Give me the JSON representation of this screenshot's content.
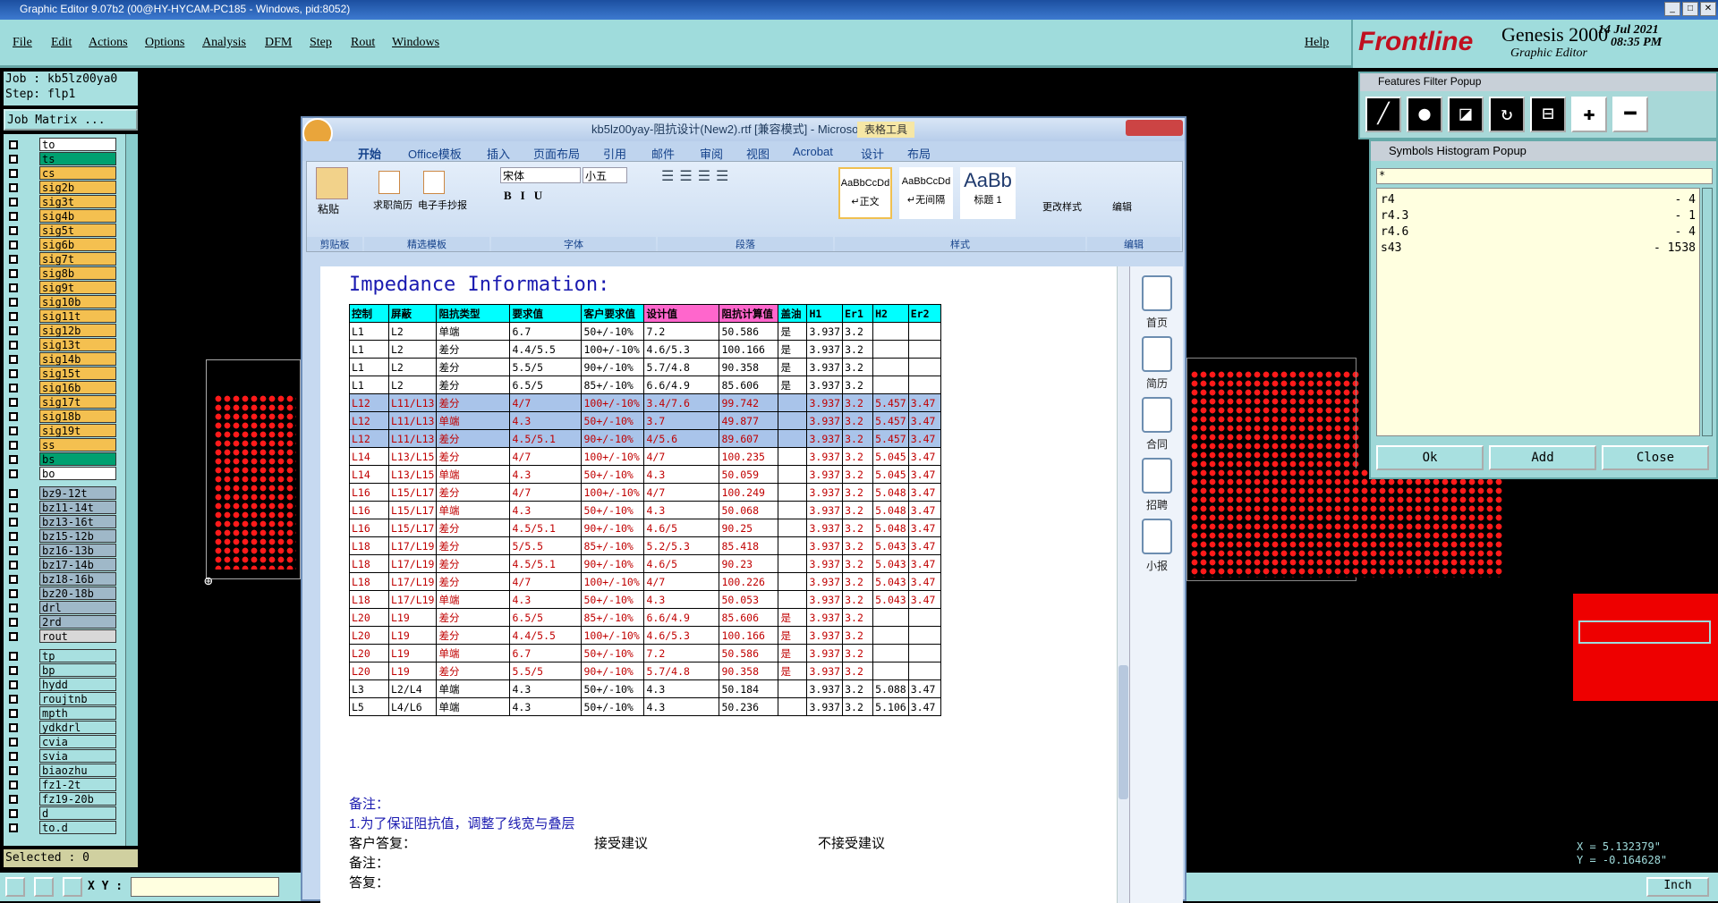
{
  "window_title": "Graphic Editor 9.07b2 (00@HY-HYCAM-PC185 - Windows, pid:8052)",
  "menu": [
    "File",
    "Edit",
    "Actions",
    "Options",
    "Analysis",
    "DFM",
    "Step",
    "Rout",
    "Windows"
  ],
  "help": "Help",
  "brand": {
    "logo": "Frontline",
    "product": "Genesis 2000",
    "subtitle": "Graphic Editor",
    "date": "14 Jul 2021",
    "time": "08:35 PM"
  },
  "job": "Job : kb5lz00ya0",
  "step": "Step: flp1",
  "job_matrix": "Job Matrix ...",
  "layers": [
    {
      "n": "to",
      "c": "#ffffff"
    },
    {
      "n": "ts",
      "c": "#00a070"
    },
    {
      "n": "cs",
      "c": "#f4c050"
    },
    {
      "n": "sig2b",
      "c": "#f4c050"
    },
    {
      "n": "sig3t",
      "c": "#f4c050"
    },
    {
      "n": "sig4b",
      "c": "#f4c050"
    },
    {
      "n": "sig5t",
      "c": "#f4c050"
    },
    {
      "n": "sig6b",
      "c": "#f4c050"
    },
    {
      "n": "sig7t",
      "c": "#f4c050"
    },
    {
      "n": "sig8b",
      "c": "#f4c050"
    },
    {
      "n": "sig9t",
      "c": "#f4c050"
    },
    {
      "n": "sig10b",
      "c": "#f4c050"
    },
    {
      "n": "sig11t",
      "c": "#f4c050"
    },
    {
      "n": "sig12b",
      "c": "#f4c050"
    },
    {
      "n": "sig13t",
      "c": "#f4c050"
    },
    {
      "n": "sig14b",
      "c": "#f4c050"
    },
    {
      "n": "sig15t",
      "c": "#f4c050"
    },
    {
      "n": "sig16b",
      "c": "#f4c050"
    },
    {
      "n": "sig17t",
      "c": "#f4c050"
    },
    {
      "n": "sig18b",
      "c": "#f4c050"
    },
    {
      "n": "sig19t",
      "c": "#f4c050"
    },
    {
      "n": "ss",
      "c": "#f4c050"
    },
    {
      "n": "bs",
      "c": "#00a070"
    },
    {
      "n": "bo",
      "c": "#ffffff"
    },
    {
      "n": "bz9-12t",
      "c": "#9fb8c8"
    },
    {
      "n": "bz11-14t",
      "c": "#9fb8c8"
    },
    {
      "n": "bz13-16t",
      "c": "#9fb8c8"
    },
    {
      "n": "bz15-12b",
      "c": "#9fb8c8"
    },
    {
      "n": "bz16-13b",
      "c": "#9fb8c8"
    },
    {
      "n": "bz17-14b",
      "c": "#9fb8c8"
    },
    {
      "n": "bz18-16b",
      "c": "#9fb8c8"
    },
    {
      "n": "bz20-18b",
      "c": "#9fb8c8"
    },
    {
      "n": "drl",
      "c": "#9fb8c8"
    },
    {
      "n": "2rd",
      "c": "#9fb8c8"
    },
    {
      "n": "rout",
      "c": "#d8d8d8"
    },
    {
      "n": "tp",
      "c": "#a8e0e0"
    },
    {
      "n": "bp",
      "c": "#a8e0e0"
    },
    {
      "n": "hydd",
      "c": "#a8e0e0"
    },
    {
      "n": "roujtnb",
      "c": "#a8e0e0"
    },
    {
      "n": "mpth",
      "c": "#a8e0e0"
    },
    {
      "n": "ydkdrl",
      "c": "#a8e0e0"
    },
    {
      "n": "cvia",
      "c": "#a8e0e0"
    },
    {
      "n": "svia",
      "c": "#a8e0e0"
    },
    {
      "n": "biaozhu",
      "c": "#a8e0e0"
    },
    {
      "n": "fz1-2t",
      "c": "#a8e0e0"
    },
    {
      "n": "fz19-20b",
      "c": "#a8e0e0"
    },
    {
      "n": "d",
      "c": "#a8e0e0"
    },
    {
      "n": "to.d",
      "c": "#a8e0e0"
    }
  ],
  "selected": "Selected : 0",
  "xy_label": "X Y :",
  "units": "Inch",
  "coords": {
    "x": "X = 5.132379\"",
    "y": "Y = -0.164628\""
  },
  "features_popup": {
    "title": "Features Filter Popup"
  },
  "hist_popup": {
    "title": "Symbols Histogram Popup",
    "filter": "*",
    "rows": [
      [
        "r4",
        "- 4"
      ],
      [
        "r4.3",
        "- 1"
      ],
      [
        "r4.6",
        "- 4"
      ],
      [
        "s43",
        "- 1538"
      ]
    ],
    "ok": "Ok",
    "add": "Add",
    "close": "Close"
  },
  "word": {
    "title": "kb5lz00yay-阻抗设计(New2).rtf [兼容模式] - Microsoft Word",
    "context_tab": "表格工具",
    "tabs": [
      "开始",
      "Office模板",
      "插入",
      "页面布局",
      "引用",
      "邮件",
      "审阅",
      "视图",
      "Acrobat",
      "设计",
      "布局"
    ],
    "groups": [
      "剪贴板",
      "精选模板",
      "字体",
      "段落",
      "样式",
      "编辑"
    ],
    "buttons": {
      "paste": "粘贴",
      "resume": "求职简历",
      "handwriting": "电子手抄报",
      "font": "宋体",
      "size": "小五",
      "style1": "AaBbCcDd",
      "style1_name": "↵正文",
      "style2": "AaBbCcDd",
      "style2_name": "↵无间隔",
      "style3": "AaBb",
      "style3_name": "标题 1",
      "change_style": "更改样式",
      "edit": "编辑"
    },
    "side": [
      "首页",
      "简历",
      "合同",
      "招聘",
      "小报"
    ],
    "heading": "Impedance Information:",
    "headers": [
      "控制",
      "屏蔽",
      "阻抗类型",
      "要求值",
      "客户要求值",
      "设计值",
      "阻抗计算值",
      "盖油",
      "H1",
      "Er1",
      "H2",
      "Er2"
    ],
    "header_colors": [
      "#00ffff",
      "#00ffff",
      "#00ffff",
      "#00ffff",
      "#00ffff",
      "#ff66cc",
      "#ff66cc",
      "#00ffff",
      "#00ffff",
      "#00ffff",
      "#00ffff",
      "#00ffff"
    ],
    "rows": [
      [
        "L1",
        "L2",
        "单端",
        "6.7",
        "50+/-10%",
        "7.2",
        "50.586",
        "是",
        "3.937",
        "3.2",
        "",
        ""
      ],
      [
        "L1",
        "L2",
        "差分",
        "4.4/5.5",
        "100+/-10%",
        "4.6/5.3",
        "100.166",
        "是",
        "3.937",
        "3.2",
        "",
        ""
      ],
      [
        "L1",
        "L2",
        "差分",
        "5.5/5",
        "90+/-10%",
        "5.7/4.8",
        "90.358",
        "是",
        "3.937",
        "3.2",
        "",
        ""
      ],
      [
        "L1",
        "L2",
        "差分",
        "6.5/5",
        "85+/-10%",
        "6.6/4.9",
        "85.606",
        "是",
        "3.937",
        "3.2",
        "",
        ""
      ],
      [
        "L12",
        "L11/L13",
        "差分",
        "4/7",
        "100+/-10%",
        "3.4/7.6",
        "99.742",
        "",
        "3.937",
        "3.2",
        "5.457",
        "3.47"
      ],
      [
        "L12",
        "L11/L13",
        "单端",
        "4.3",
        "50+/-10%",
        "3.7",
        "49.877",
        "",
        "3.937",
        "3.2",
        "5.457",
        "3.47"
      ],
      [
        "L12",
        "L11/L13",
        "差分",
        "4.5/5.1",
        "90+/-10%",
        "4/5.6",
        "89.607",
        "",
        "3.937",
        "3.2",
        "5.457",
        "3.47"
      ],
      [
        "L14",
        "L13/L15",
        "差分",
        "4/7",
        "100+/-10%",
        "4/7",
        "100.235",
        "",
        "3.937",
        "3.2",
        "5.045",
        "3.47"
      ],
      [
        "L14",
        "L13/L15",
        "单端",
        "4.3",
        "50+/-10%",
        "4.3",
        "50.059",
        "",
        "3.937",
        "3.2",
        "5.045",
        "3.47"
      ],
      [
        "L16",
        "L15/L17",
        "差分",
        "4/7",
        "100+/-10%",
        "4/7",
        "100.249",
        "",
        "3.937",
        "3.2",
        "5.048",
        "3.47"
      ],
      [
        "L16",
        "L15/L17",
        "单端",
        "4.3",
        "50+/-10%",
        "4.3",
        "50.068",
        "",
        "3.937",
        "3.2",
        "5.048",
        "3.47"
      ],
      [
        "L16",
        "L15/L17",
        "差分",
        "4.5/5.1",
        "90+/-10%",
        "4.6/5",
        "90.25",
        "",
        "3.937",
        "3.2",
        "5.048",
        "3.47"
      ],
      [
        "L18",
        "L17/L19",
        "差分",
        "5/5.5",
        "85+/-10%",
        "5.2/5.3",
        "85.418",
        "",
        "3.937",
        "3.2",
        "5.043",
        "3.47"
      ],
      [
        "L18",
        "L17/L19",
        "差分",
        "4.5/5.1",
        "90+/-10%",
        "4.6/5",
        "90.23",
        "",
        "3.937",
        "3.2",
        "5.043",
        "3.47"
      ],
      [
        "L18",
        "L17/L19",
        "差分",
        "4/7",
        "100+/-10%",
        "4/7",
        "100.226",
        "",
        "3.937",
        "3.2",
        "5.043",
        "3.47"
      ],
      [
        "L18",
        "L17/L19",
        "单端",
        "4.3",
        "50+/-10%",
        "4.3",
        "50.053",
        "",
        "3.937",
        "3.2",
        "5.043",
        "3.47"
      ],
      [
        "L20",
        "L19",
        "差分",
        "6.5/5",
        "85+/-10%",
        "6.6/4.9",
        "85.606",
        "是",
        "3.937",
        "3.2",
        "",
        ""
      ],
      [
        "L20",
        "L19",
        "差分",
        "4.4/5.5",
        "100+/-10%",
        "4.6/5.3",
        "100.166",
        "是",
        "3.937",
        "3.2",
        "",
        ""
      ],
      [
        "L20",
        "L19",
        "单端",
        "6.7",
        "50+/-10%",
        "7.2",
        "50.586",
        "是",
        "3.937",
        "3.2",
        "",
        ""
      ],
      [
        "L20",
        "L19",
        "差分",
        "5.5/5",
        "90+/-10%",
        "5.7/4.8",
        "90.358",
        "是",
        "3.937",
        "3.2",
        "",
        ""
      ],
      [
        "L3",
        "L2/L4",
        "单端",
        "4.3",
        "50+/-10%",
        "4.3",
        "50.184",
        "",
        "3.937",
        "3.2",
        "5.088",
        "3.47"
      ],
      [
        "L5",
        "L4/L6",
        "单端",
        "4.3",
        "50+/-10%",
        "4.3",
        "50.236",
        "",
        "3.937",
        "3.2",
        "5.106",
        "3.47"
      ]
    ],
    "row_style": [
      "",
      "",
      "",
      "",
      "sel",
      "sel",
      "sel",
      "red",
      "red",
      "red",
      "red",
      "red",
      "red",
      "red",
      "red",
      "red",
      "red",
      "red",
      "red",
      "red",
      "",
      ""
    ],
    "notes": {
      "n1": "备注：",
      "n2": "1.为了保证阻抗值，调整了线宽与叠层",
      "n3": "客户答复：",
      "n4": "接受建议",
      "n5": "不接受建议",
      "n6": "备注：",
      "n7": "答复："
    }
  }
}
